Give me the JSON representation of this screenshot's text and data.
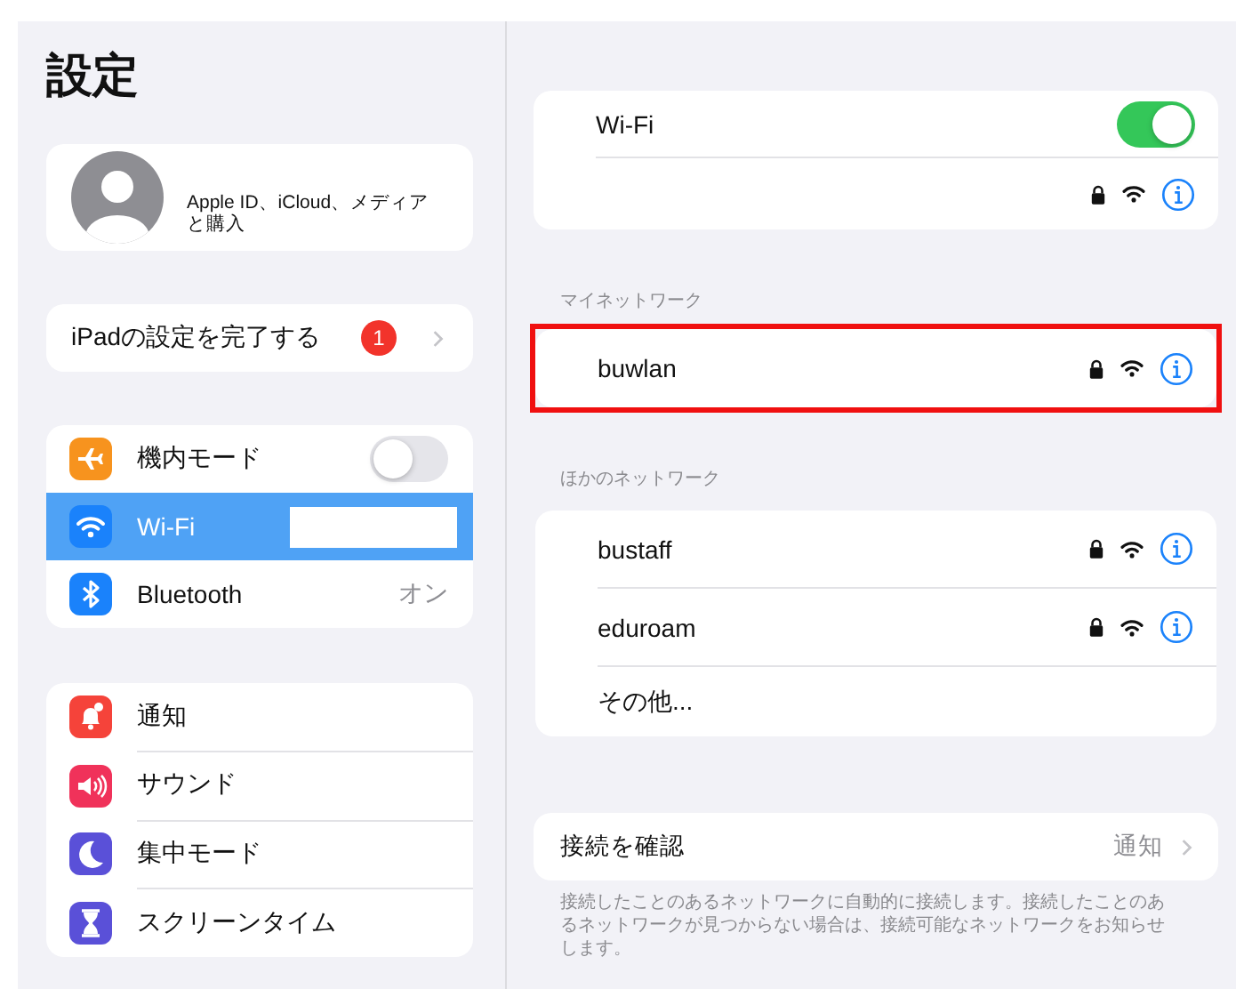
{
  "sidebar": {
    "title": "設定",
    "profile": {
      "label": "Apple ID、iCloud、メディアと購入"
    },
    "setup": {
      "label": "iPadの設定を完了する",
      "badge": "1"
    },
    "groups": [
      {
        "items": [
          {
            "label": "機内モード",
            "kind": "toggle",
            "on": false,
            "selected": false
          },
          {
            "label": "Wi-Fi",
            "kind": "plain",
            "redacted": true,
            "selected": true
          },
          {
            "label": "Bluetooth",
            "kind": "value",
            "value": "オン",
            "selected": false
          }
        ]
      },
      {
        "items": [
          {
            "label": "通知",
            "kind": "plain",
            "selected": false
          },
          {
            "label": "サウンド",
            "kind": "plain",
            "selected": false
          },
          {
            "label": "集中モード",
            "kind": "plain",
            "selected": false
          },
          {
            "label": "スクリーンタイム",
            "kind": "plain",
            "selected": false
          }
        ]
      }
    ]
  },
  "wifi": {
    "label": "Wi-Fi",
    "on": true,
    "current": {
      "secured": true
    }
  },
  "my_networks": {
    "heading": "マイネットワーク",
    "highlighted": true,
    "networks": [
      {
        "name": "buwlan",
        "secured": true
      }
    ]
  },
  "other_networks": {
    "heading": "ほかのネットワーク",
    "networks": [
      {
        "name": "bustaff",
        "secured": true
      },
      {
        "name": "eduroam",
        "secured": true
      }
    ],
    "other": "その他..."
  },
  "ask_to_join": {
    "label": "接続を確認",
    "value": "通知",
    "note": "接続したことのあるネットワークに自動的に接続します。接続したことのあるネットワークが見つからない場合は、接続可能なネットワークをお知らせします。"
  }
}
